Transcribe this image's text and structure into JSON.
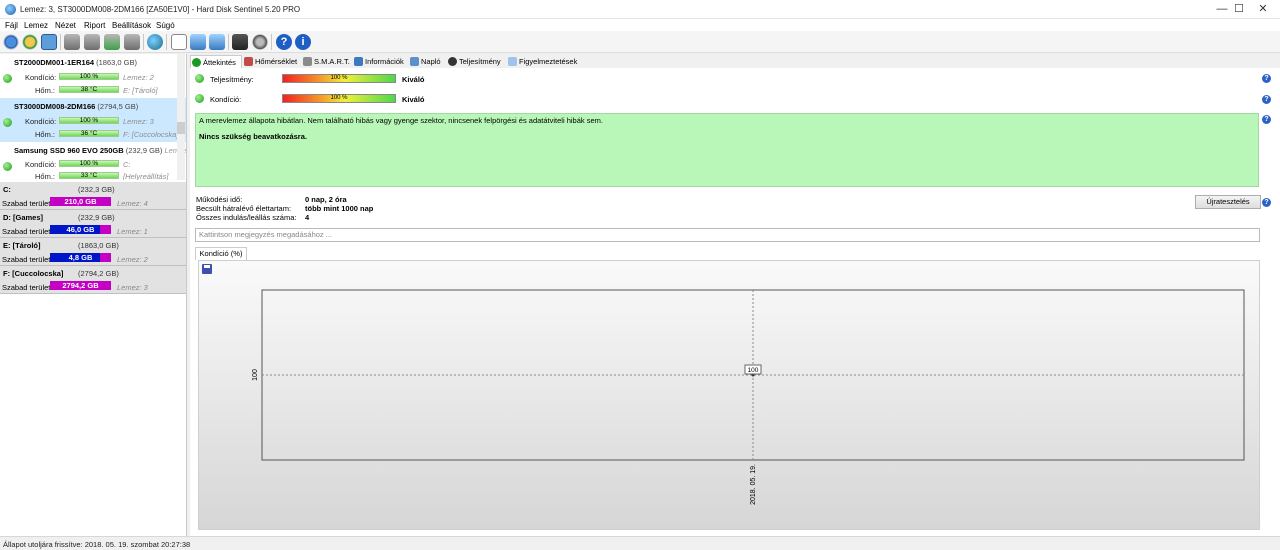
{
  "window": {
    "title": "Lemez: 3, ST3000DM008-2DM166 [ZA50E1V0]  -  Hard Disk Sentinel 5.20 PRO",
    "minimize": "—",
    "maximize": "☐",
    "close": "✕"
  },
  "menu": [
    "Fájl",
    "Lemez",
    "Nézet",
    "Riport",
    "Beállítások",
    "Súgó"
  ],
  "toolbar_icons": [
    "refresh-icon",
    "disk-info-icon",
    "report-icon",
    "disk-test-icon",
    "disk-test-2-icon",
    "disk-test-3-icon",
    "disk-test-4-icon",
    "globe-icon",
    "document-icon",
    "settings-icon",
    "network-icon",
    "alert-icon",
    "tools-icon",
    "help-icon",
    "info-icon"
  ],
  "disks": [
    {
      "name": "ST2000DM001-1ER164",
      "size": "(1863,0 GB)",
      "health_label": "Kondíció:",
      "health": "100 %",
      "temp_label": "Hőm.:",
      "temp": "38 °C",
      "disk_no": "Lemez: 2",
      "volume": "E: [Tároló]"
    },
    {
      "name": "ST3000DM008-2DM166",
      "size": "(2794,5 GB)",
      "health_label": "Kondíció:",
      "health": "100 %",
      "temp_label": "Hőm.:",
      "temp": "36 °C",
      "disk_no": "Lemez: 3",
      "volume": "F: [Cuccolocska]"
    },
    {
      "name": "Samsung SSD 960 EVO 250GB",
      "size": "(232,9 GB)",
      "health_label": "Kondíció:",
      "health": "100 %",
      "temp_label": "Hőm.:",
      "temp": "33 °C",
      "disk_no": "Lemez",
      "volume": "C:",
      "extra": "[Helyreállítás]"
    }
  ],
  "partitions": [
    {
      "name": "C:",
      "size": "(232,3 GB)",
      "free_label": "Szabad terület",
      "free": "210,0 GB",
      "disk": "Lemez: 4",
      "color": "#c400c4"
    },
    {
      "name": "D: [Games]",
      "size": "(232,9 GB)",
      "free_label": "Szabad terület",
      "free": "46,0 GB",
      "disk": "Lemez: 1",
      "color": "#0016c8"
    },
    {
      "name": "E: [Tároló]",
      "size": "(1863,0 GB)",
      "free_label": "Szabad terület",
      "free": "4,8 GB",
      "disk": "Lemez: 2",
      "color": "#0016c8"
    },
    {
      "name": "F: [Cuccolocska]",
      "size": "(2794,2 GB)",
      "free_label": "Szabad terület",
      "free": "2794,2 GB",
      "disk": "Lemez: 3",
      "color": "#c400c4"
    }
  ],
  "tabs": [
    "Áttekintés",
    "Hőmérséklet",
    "S.M.A.R.T.",
    "Információk",
    "Napló",
    "Teljesítmény",
    "Figyelmeztetések"
  ],
  "overview": {
    "performance_label": "Teljesítmény:",
    "performance_value": "100 %",
    "performance_rating": "Kiváló",
    "health_label": "Kondíció:",
    "health_value": "100 %",
    "health_rating": "Kiváló",
    "message": "A merevlemez állapota hibátlan. Nem található hibás vagy gyenge szektor, nincsenek felpörgési és adatátviteli hibák sem.",
    "recommendation": "Nincs szükség beavatkozásra.",
    "uptime_label": "Működési idő:",
    "uptime_value": "0 nap, 2 óra",
    "lifetime_label": "Becsült hátralévő élettartam:",
    "lifetime_value": "több mint 1000 nap",
    "startstop_label": "Összes indulás/leállás száma:",
    "startstop_value": "4",
    "retest_button": "Újratesztelés",
    "comment_placeholder": "Kattintson megjegyzés megadásához ...",
    "help": "?"
  },
  "chart_tab": "Kondíció  (%)",
  "chart_data": {
    "type": "line",
    "x": [
      "2018. 05. 19."
    ],
    "series": [
      {
        "values": [
          100
        ]
      }
    ],
    "ylabel_tick": "100",
    "point_label": "100",
    "xlabel_tick": "2018. 05. 19.",
    "grid": true
  },
  "status": "Állapot utoljára frissítve: 2018. 05. 19. szombat 20:27:38"
}
